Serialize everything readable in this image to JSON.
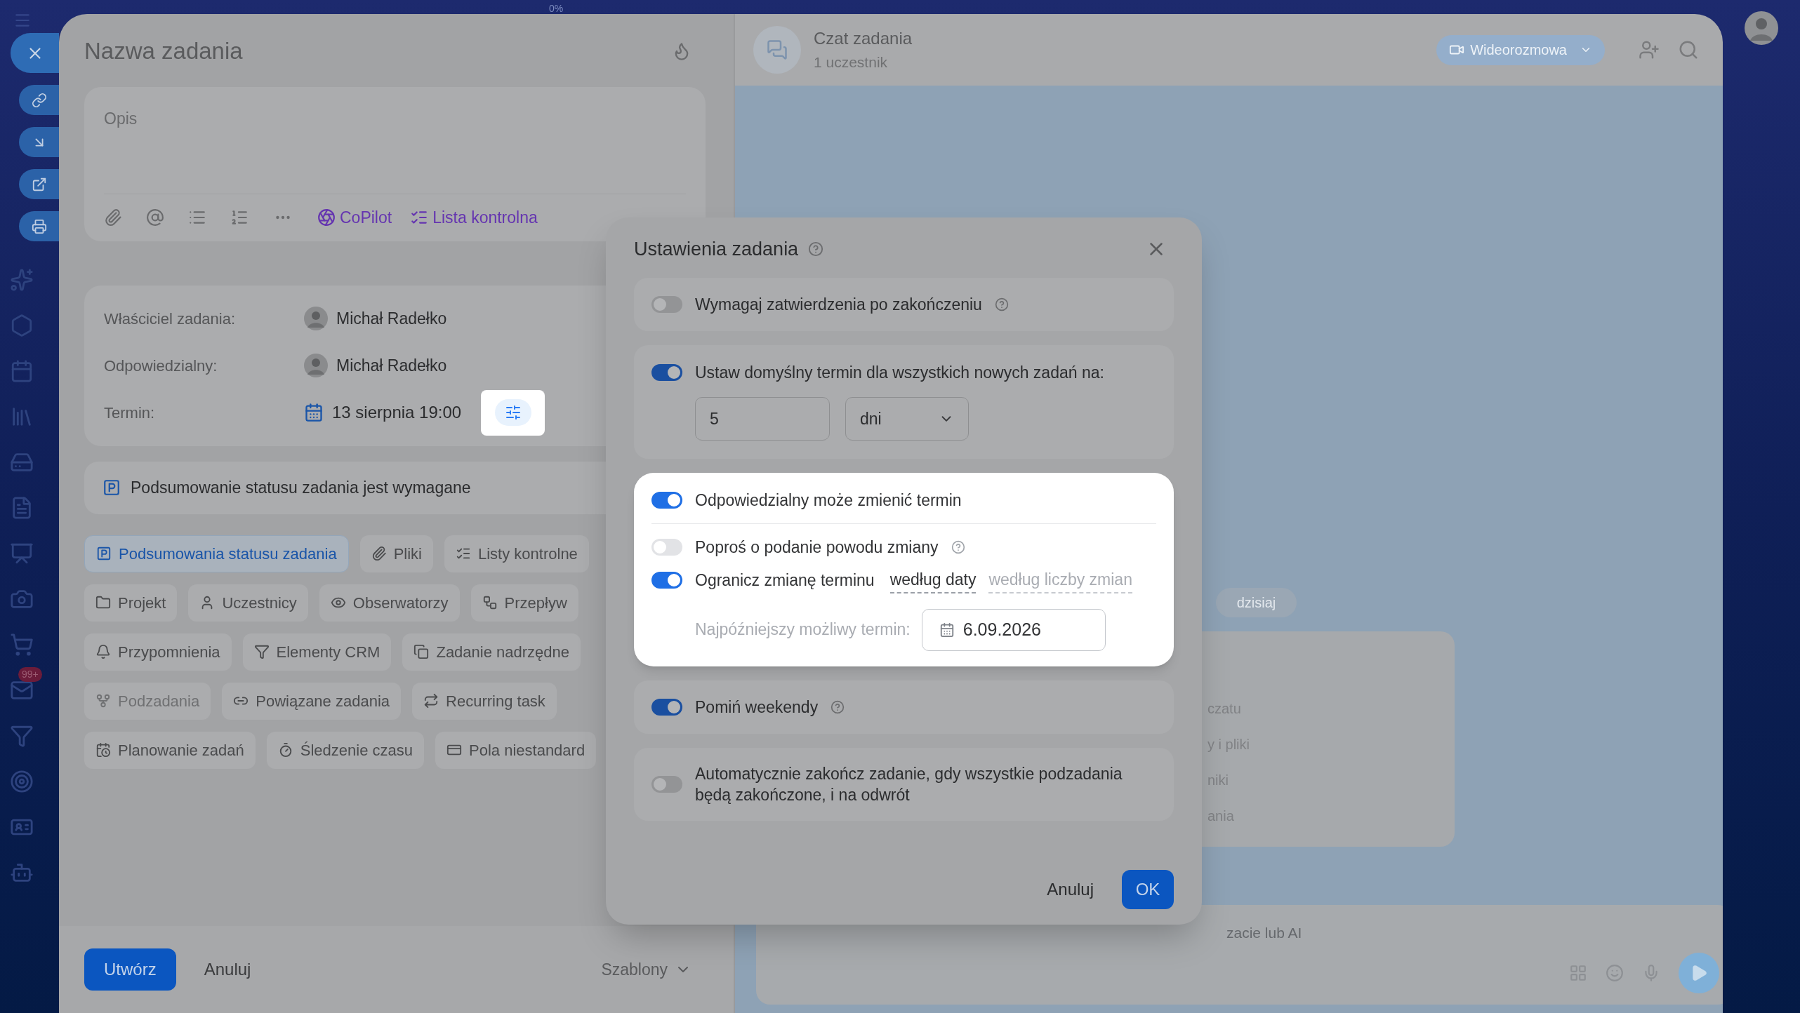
{
  "top_bar": {
    "progress": "0%"
  },
  "sidebar": {
    "mail_badge": "99+"
  },
  "task": {
    "title": "Nazwa zadania",
    "description_placeholder": "Opis",
    "toolbar_links": [
      {
        "label": "CoPilot"
      },
      {
        "label": "Lista kontrolna"
      }
    ],
    "fields": [
      {
        "kind": "person",
        "label": "Właściciel zadania:",
        "value": "Michał Radełko"
      },
      {
        "kind": "person",
        "label": "Odpowiedzialny:",
        "value": "Michał Radełko"
      },
      {
        "kind": "deadline",
        "label": "Termin:",
        "value": "13 sierpnia 19:00",
        "settings_highlighted": true
      }
    ],
    "summary_notice": "Podsumowanie statusu zadania jest wymagane",
    "chip_rows": [
      [
        {
          "label": "Podsumowania statusu zadania",
          "selected": true,
          "disabled": false
        },
        {
          "label": "Pliki",
          "selected": false,
          "disabled": false
        },
        {
          "label": "Listy kontrolne",
          "selected": false,
          "disabled": false
        }
      ],
      [
        {
          "label": "Projekt",
          "selected": false,
          "disabled": false
        },
        {
          "label": "Uczestnicy",
          "selected": false,
          "disabled": false
        },
        {
          "label": "Obserwatorzy",
          "selected": false,
          "disabled": false
        },
        {
          "label": "Przepływ",
          "selected": false,
          "disabled": false
        }
      ],
      [
        {
          "label": "Przypomnienia",
          "selected": false,
          "disabled": false
        },
        {
          "label": "Elementy CRM",
          "selected": false,
          "disabled": false
        },
        {
          "label": "Zadanie nadrzędne",
          "selected": false,
          "disabled": false
        }
      ],
      [
        {
          "label": "Podzadania",
          "selected": false,
          "disabled": true
        },
        {
          "label": "Powiązane zadania",
          "selected": false,
          "disabled": false
        },
        {
          "label": "Recurring task",
          "selected": false,
          "disabled": false
        }
      ],
      [
        {
          "label": "Planowanie zadań",
          "selected": false,
          "disabled": false
        },
        {
          "label": "Śledzenie czasu",
          "selected": false,
          "disabled": false
        },
        {
          "label": "Pola niestandard",
          "selected": false,
          "disabled": false
        }
      ]
    ],
    "footer": {
      "create": "Utwórz",
      "cancel": "Anuluj",
      "templates": "Szablony"
    }
  },
  "chat": {
    "title": "Czat zadania",
    "subtitle": "1 uczestnik",
    "video_button": "Wideorozmowa",
    "date_pill": "dzisiaj",
    "card_lines": [
      "czatu",
      "y i pliki",
      "niki",
      "ania"
    ],
    "input_placeholder": "zacie lub AI"
  },
  "dialog": {
    "title": "Ustawienia zadania",
    "settings": [
      {
        "kind": "toggle",
        "label": "Wymagaj zatwierdzenia po zakończeniu",
        "on": false,
        "help": true
      },
      {
        "kind": "term",
        "label": "Ustaw domyślny termin dla wszystkich nowych zadań na:",
        "on": true,
        "amount": "5",
        "unit": "dni"
      },
      {
        "kind": "group",
        "highlighted": true,
        "items": [
          {
            "kind": "toggle",
            "label": "Odpowiedzialny może zmienić termin",
            "on": true,
            "help": false
          },
          {
            "kind": "toggle",
            "label": "Poproś o podanie powodu zmiany",
            "on": false,
            "help": true
          },
          {
            "kind": "limit",
            "label": "Ogranicz zmianę terminu",
            "on": true,
            "modes": [
              {
                "label": "według daty",
                "selected": true
              },
              {
                "label": "według liczby zmian",
                "selected": false
              }
            ],
            "date_label": "Najpóźniejszy możliwy termin:",
            "date": "6.09.2026"
          }
        ]
      },
      {
        "kind": "toggle",
        "label": "Pomiń weekendy",
        "on": true,
        "help": true
      },
      {
        "kind": "toggle",
        "label": "Automatycznie zakończ zadanie, gdy wszystkie podzadania będą zakończone, i na odwrót",
        "on": false,
        "help": false
      }
    ],
    "cancel": "Anuluj",
    "ok": "OK"
  }
}
